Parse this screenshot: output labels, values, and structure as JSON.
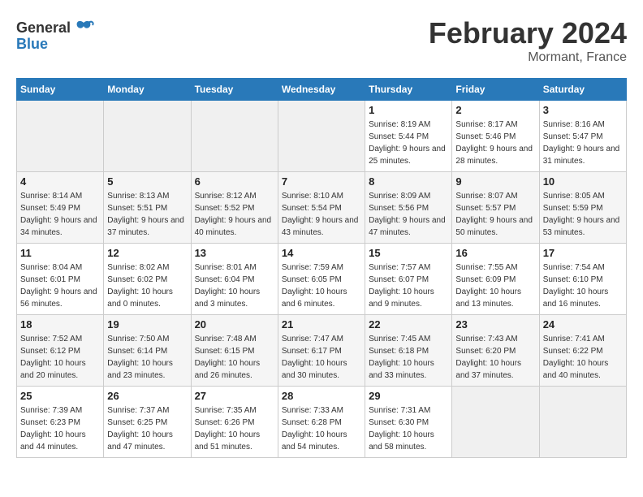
{
  "header": {
    "logo_line1": "General",
    "logo_line2": "Blue",
    "title": "February 2024",
    "subtitle": "Mormant, France"
  },
  "calendar": {
    "days_of_week": [
      "Sunday",
      "Monday",
      "Tuesday",
      "Wednesday",
      "Thursday",
      "Friday",
      "Saturday"
    ],
    "weeks": [
      [
        {
          "day": "",
          "empty": true
        },
        {
          "day": "",
          "empty": true
        },
        {
          "day": "",
          "empty": true
        },
        {
          "day": "",
          "empty": true
        },
        {
          "day": "1",
          "sunrise": "8:19 AM",
          "sunset": "5:44 PM",
          "daylight": "9 hours and 25 minutes."
        },
        {
          "day": "2",
          "sunrise": "8:17 AM",
          "sunset": "5:46 PM",
          "daylight": "9 hours and 28 minutes."
        },
        {
          "day": "3",
          "sunrise": "8:16 AM",
          "sunset": "5:47 PM",
          "daylight": "9 hours and 31 minutes."
        }
      ],
      [
        {
          "day": "4",
          "sunrise": "8:14 AM",
          "sunset": "5:49 PM",
          "daylight": "9 hours and 34 minutes."
        },
        {
          "day": "5",
          "sunrise": "8:13 AM",
          "sunset": "5:51 PM",
          "daylight": "9 hours and 37 minutes."
        },
        {
          "day": "6",
          "sunrise": "8:12 AM",
          "sunset": "5:52 PM",
          "daylight": "9 hours and 40 minutes."
        },
        {
          "day": "7",
          "sunrise": "8:10 AM",
          "sunset": "5:54 PM",
          "daylight": "9 hours and 43 minutes."
        },
        {
          "day": "8",
          "sunrise": "8:09 AM",
          "sunset": "5:56 PM",
          "daylight": "9 hours and 47 minutes."
        },
        {
          "day": "9",
          "sunrise": "8:07 AM",
          "sunset": "5:57 PM",
          "daylight": "9 hours and 50 minutes."
        },
        {
          "day": "10",
          "sunrise": "8:05 AM",
          "sunset": "5:59 PM",
          "daylight": "9 hours and 53 minutes."
        }
      ],
      [
        {
          "day": "11",
          "sunrise": "8:04 AM",
          "sunset": "6:01 PM",
          "daylight": "9 hours and 56 minutes."
        },
        {
          "day": "12",
          "sunrise": "8:02 AM",
          "sunset": "6:02 PM",
          "daylight": "10 hours and 0 minutes."
        },
        {
          "day": "13",
          "sunrise": "8:01 AM",
          "sunset": "6:04 PM",
          "daylight": "10 hours and 3 minutes."
        },
        {
          "day": "14",
          "sunrise": "7:59 AM",
          "sunset": "6:05 PM",
          "daylight": "10 hours and 6 minutes."
        },
        {
          "day": "15",
          "sunrise": "7:57 AM",
          "sunset": "6:07 PM",
          "daylight": "10 hours and 9 minutes."
        },
        {
          "day": "16",
          "sunrise": "7:55 AM",
          "sunset": "6:09 PM",
          "daylight": "10 hours and 13 minutes."
        },
        {
          "day": "17",
          "sunrise": "7:54 AM",
          "sunset": "6:10 PM",
          "daylight": "10 hours and 16 minutes."
        }
      ],
      [
        {
          "day": "18",
          "sunrise": "7:52 AM",
          "sunset": "6:12 PM",
          "daylight": "10 hours and 20 minutes."
        },
        {
          "day": "19",
          "sunrise": "7:50 AM",
          "sunset": "6:14 PM",
          "daylight": "10 hours and 23 minutes."
        },
        {
          "day": "20",
          "sunrise": "7:48 AM",
          "sunset": "6:15 PM",
          "daylight": "10 hours and 26 minutes."
        },
        {
          "day": "21",
          "sunrise": "7:47 AM",
          "sunset": "6:17 PM",
          "daylight": "10 hours and 30 minutes."
        },
        {
          "day": "22",
          "sunrise": "7:45 AM",
          "sunset": "6:18 PM",
          "daylight": "10 hours and 33 minutes."
        },
        {
          "day": "23",
          "sunrise": "7:43 AM",
          "sunset": "6:20 PM",
          "daylight": "10 hours and 37 minutes."
        },
        {
          "day": "24",
          "sunrise": "7:41 AM",
          "sunset": "6:22 PM",
          "daylight": "10 hours and 40 minutes."
        }
      ],
      [
        {
          "day": "25",
          "sunrise": "7:39 AM",
          "sunset": "6:23 PM",
          "daylight": "10 hours and 44 minutes."
        },
        {
          "day": "26",
          "sunrise": "7:37 AM",
          "sunset": "6:25 PM",
          "daylight": "10 hours and 47 minutes."
        },
        {
          "day": "27",
          "sunrise": "7:35 AM",
          "sunset": "6:26 PM",
          "daylight": "10 hours and 51 minutes."
        },
        {
          "day": "28",
          "sunrise": "7:33 AM",
          "sunset": "6:28 PM",
          "daylight": "10 hours and 54 minutes."
        },
        {
          "day": "29",
          "sunrise": "7:31 AM",
          "sunset": "6:30 PM",
          "daylight": "10 hours and 58 minutes."
        },
        {
          "day": "",
          "empty": true
        },
        {
          "day": "",
          "empty": true
        }
      ]
    ],
    "labels": {
      "sunrise": "Sunrise:",
      "sunset": "Sunset:",
      "daylight": "Daylight:"
    }
  }
}
